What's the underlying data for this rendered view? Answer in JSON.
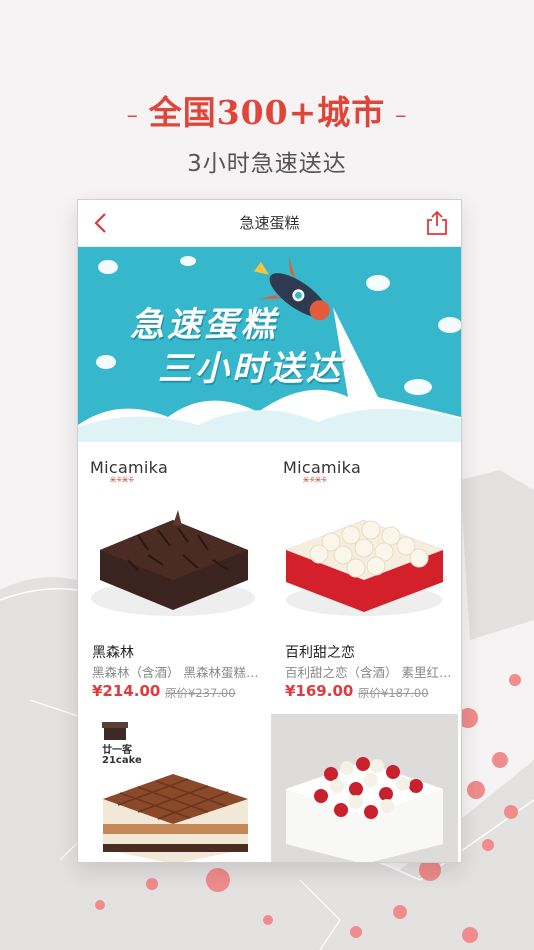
{
  "promo": {
    "title": "全国300+城市",
    "subtitle": "3小时急速送达"
  },
  "nav": {
    "title": "急速蛋糕",
    "back_icon": "chevron-left-icon",
    "share_icon": "share-icon"
  },
  "banner": {
    "line1": "急速蛋糕",
    "line2": "三小时送达"
  },
  "products": [
    {
      "brand": "Micamika",
      "brand_sub": "米卡米卡",
      "name": "黑森林",
      "desc": "黑森林（含酒） 黑森林蛋糕…",
      "price": "¥214.00",
      "orig_price": "原价¥237.00"
    },
    {
      "brand": "Micamika",
      "brand_sub": "米卡米卡",
      "name": "百利甜之恋",
      "desc": "百利甜之恋（含酒） 素里红…",
      "price": "¥169.00",
      "orig_price": "原价¥187.00"
    },
    {
      "brand": "21cake",
      "brand_sub": "廿一客"
    },
    {
      "brand": ""
    }
  ],
  "colors": {
    "accent": "#e0453a",
    "price": "#e3393c",
    "banner": "#36b7cc"
  }
}
